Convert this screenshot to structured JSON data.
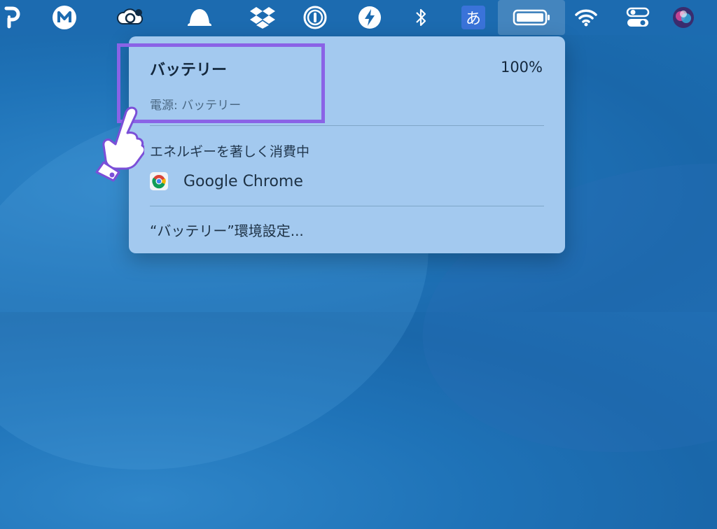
{
  "menubar": {
    "icons": [
      "p-icon",
      "m-icon",
      "cloud-sync-icon",
      "bell-icon",
      "dropbox-icon",
      "onepassword-icon",
      "bolt-icon",
      "bluetooth-icon",
      "input-method-icon",
      "battery-icon",
      "wifi-icon",
      "control-center-icon",
      "siri-icon"
    ],
    "input_method_label": "あ"
  },
  "battery_menu": {
    "title": "バッテリー",
    "percent": "100%",
    "power_source": "電源: バッテリー",
    "section_heading": "エネルギーを著しく消費中",
    "apps": [
      {
        "name": "Google Chrome"
      }
    ],
    "prefs_label": "“バッテリー”環境設定..."
  },
  "colors": {
    "highlight_border": "#8a63e6",
    "menu_bg": "#a3c9ef",
    "desktop": "#1f73b8"
  }
}
